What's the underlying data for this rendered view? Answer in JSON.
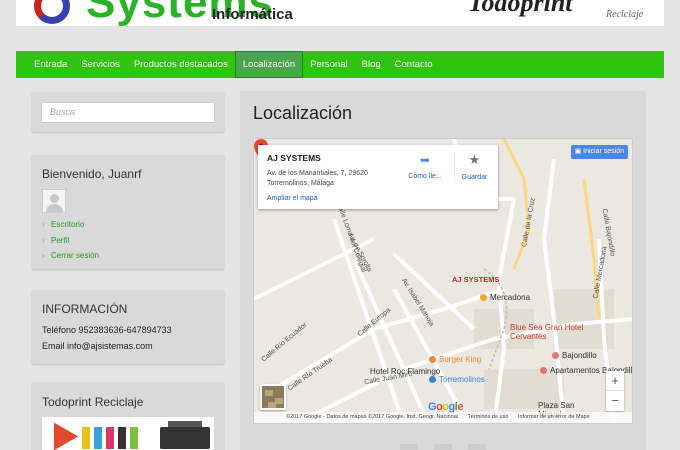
{
  "header": {
    "logo_left_main": "AJ Systems",
    "logo_left_sub": "Informática",
    "logo_right_main": "Todoprint",
    "logo_right_sub": "Reciclaje"
  },
  "nav": {
    "items": [
      "Entrada",
      "Servicios",
      "Productos destacados",
      "Localización",
      "Personal",
      "Blog",
      "Contacto"
    ],
    "active": "Localización"
  },
  "search": {
    "placeholder": "Busca"
  },
  "welcome": {
    "title": "Bienvenido, Juanrf",
    "links": [
      "Escritorio",
      "Perfil",
      "Cerrar sesión"
    ]
  },
  "info": {
    "title": "INFORMACIÓN",
    "phone": "Teléfono 952383636-647894733",
    "email": "Email info@ajsistemas.com"
  },
  "todoprint": {
    "title": "Todoprint Reciclaje"
  },
  "main": {
    "title": "Localización"
  },
  "map": {
    "place_name": "AJ SYSTEMS",
    "address_line1": "Av. de los Manantiales, 7, 29620",
    "address_line2": "Torremolinos, Málaga",
    "enlarge_link": "Ampliar el mapa",
    "directions_label": "Cómo lle...",
    "save_label": "Guardar",
    "signin_label": "Iniciar sesión",
    "pin_label": "AJ SYSTEMS",
    "google_logo": "Google",
    "attribution": [
      "©2017 Google - Datos de mapas ©2017 Google, Inst. Geogr. Nacional",
      "Términos de uso",
      "Informar de un error de Maps"
    ],
    "zoom_in": "+",
    "zoom_out": "−",
    "streets": [
      "Av. de Sorolla",
      "Calle Loma del Colegial",
      "Calle Europa",
      "Calle Río Trueba",
      "Av. Isabel Manoja",
      "Calle Río Ecuador",
      "Calle de la Cruz",
      "Calle Mercadona",
      "Calle Juan Miró",
      "Calle Bajondillo"
    ],
    "pois": [
      {
        "name": "Mercadona",
        "color": "#f4a623"
      },
      {
        "name": "Blue Sea Gran Hotel Cervantes",
        "color": "#e57373"
      },
      {
        "name": "Burger King",
        "color": "#e98a3a"
      },
      {
        "name": "Hotel Roc Flamingo",
        "color": "#e57373"
      },
      {
        "name": "Torremolinos",
        "color": "#3b82d6"
      },
      {
        "name": "Bajondillo",
        "color": "#e57373"
      },
      {
        "name": "Apartamentos Bajondillo",
        "color": "#e57373"
      },
      {
        "name": "Plaza San Miguel",
        "color": "#777777"
      }
    ]
  }
}
